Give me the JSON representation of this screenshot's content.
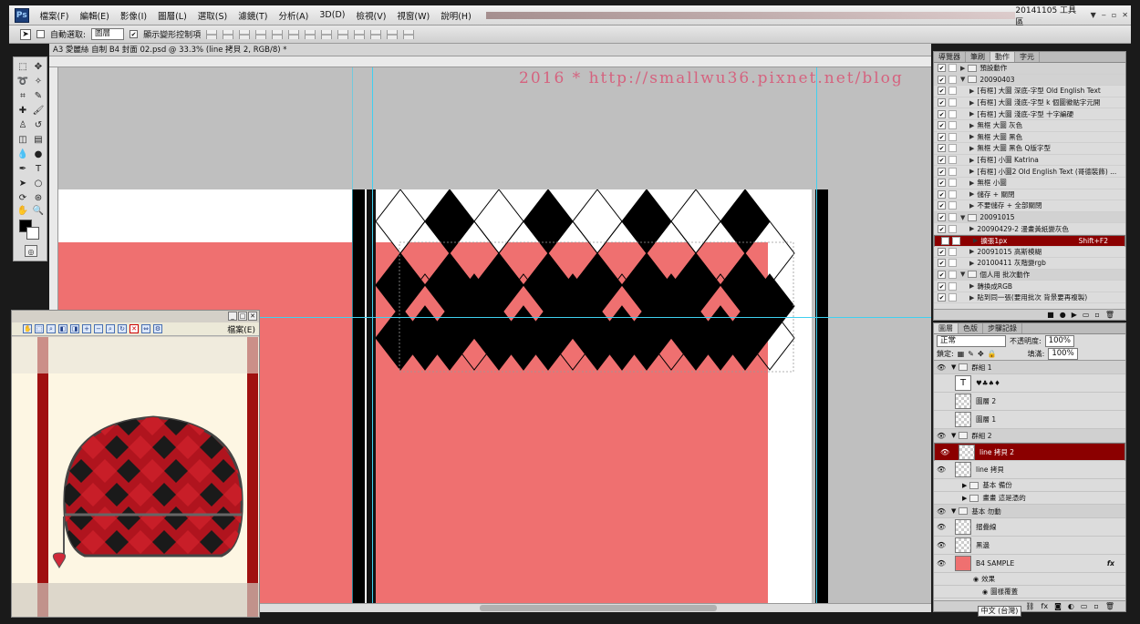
{
  "app": {
    "logo": "Ps",
    "workspace": "20141105 工具區",
    "window_buttons": [
      "‒",
      "▫",
      "✕"
    ]
  },
  "menu": [
    "檔案(F)",
    "編輯(E)",
    "影像(I)",
    "圖層(L)",
    "選取(S)",
    "濾鏡(T)",
    "分析(A)",
    "3D(D)",
    "檢視(V)",
    "視窗(W)",
    "說明(H)"
  ],
  "options": {
    "auto_select_label": "自動選取:",
    "auto_select_value": "圖層",
    "show_transform_label": "顯示變形控制項"
  },
  "document": {
    "tab": "A3 愛麗絲 自制 B4 封面 02.psd @ 33.3% (line 拷貝 2, RGB/8) *"
  },
  "watermark": "2016 * http://smallwu36.pixnet.net/blog",
  "viewer": {
    "file_label": "檔案(E)"
  },
  "actions_panel": {
    "tabs": [
      "導覽器",
      "筆刷",
      "動作",
      "字元"
    ],
    "active_tab": 2,
    "rows": [
      {
        "type": "set",
        "label": "預設動作",
        "check": "✔"
      },
      {
        "type": "set",
        "label": "20090403",
        "check": "✔",
        "open": true
      },
      {
        "type": "action",
        "label": "[有框] 大圖 深底-字型 Old English Text",
        "check": "✔"
      },
      {
        "type": "action",
        "label": "[有框] 大圖 淺底-字型 k 個圖徽骷字元開",
        "check": "✔"
      },
      {
        "type": "action",
        "label": "[有框] 大圖 淺底-字型 十字編硬",
        "check": "✔"
      },
      {
        "type": "action",
        "label": "無框 大圖 灰色",
        "check": "✔"
      },
      {
        "type": "action",
        "label": "無框 大圖 黑色",
        "check": "✔"
      },
      {
        "type": "action",
        "label": "無框 大圖 黑色 Q版字型",
        "check": "✔"
      },
      {
        "type": "action",
        "label": "[有框] 小圖 Katrina",
        "check": "✔"
      },
      {
        "type": "action",
        "label": "[有框] 小圖2 Old English Text (哥德裝飾) ...",
        "check": "✔"
      },
      {
        "type": "action",
        "label": "無框 小圖",
        "check": "✔"
      },
      {
        "type": "action",
        "label": "儲存 + 關閉",
        "check": "✔"
      },
      {
        "type": "action",
        "label": "不要儲存 + 全部關閉",
        "check": "✔"
      },
      {
        "type": "set",
        "label": "20091015",
        "check": "✔",
        "open": true
      },
      {
        "type": "action",
        "label": "20090429-2 漫畫黃紙變灰色",
        "check": "✔"
      },
      {
        "type": "action",
        "label": "擴張1px",
        "check": "✔",
        "selected": true,
        "shortcut": "Shift+F2"
      },
      {
        "type": "action",
        "label": "20091015 高斯模糊",
        "check": "✔"
      },
      {
        "type": "action",
        "label": "20100411 灰階變rgb",
        "check": "✔"
      },
      {
        "type": "set",
        "label": "個人用 批次動作",
        "check": "✔",
        "open": true
      },
      {
        "type": "action",
        "label": "轉換成RGB",
        "check": "✔"
      },
      {
        "type": "action",
        "label": "貼到同一張(要用批次 背景要再複製)",
        "check": "✔"
      }
    ]
  },
  "layers_panel": {
    "tabs": [
      "圖層",
      "色版",
      "步驟記錄"
    ],
    "blend_mode": "正常",
    "opacity_label": "不透明度:",
    "opacity": "100%",
    "lock_label": "鎖定:",
    "fill_label": "填滿:",
    "fill": "100%",
    "rows": [
      {
        "kind": "group",
        "label": "群組 1",
        "eye": "👁"
      },
      {
        "kind": "text",
        "label": "♥♣♠♦",
        "thumb": "T",
        "eye": ""
      },
      {
        "kind": "layer",
        "label": "圖層 2",
        "eye": ""
      },
      {
        "kind": "layer",
        "label": "圖層 1",
        "eye": ""
      },
      {
        "kind": "group",
        "label": "群組 2",
        "eye": "👁"
      },
      {
        "kind": "layer",
        "label": "line 拷貝 2",
        "eye": "👁",
        "selected": true
      },
      {
        "kind": "layer",
        "label": "line 拷貝",
        "eye": "👁"
      },
      {
        "kind": "subgroup",
        "label": "基本 備份",
        "eye": ""
      },
      {
        "kind": "subgroup",
        "label": "畫畫 這是憑的",
        "eye": ""
      },
      {
        "kind": "group",
        "label": "基本 勿動",
        "eye": "👁"
      },
      {
        "kind": "layer",
        "label": "摺疊線",
        "eye": "👁"
      },
      {
        "kind": "layer",
        "label": "黑邊",
        "eye": "👁"
      },
      {
        "kind": "layer",
        "label": "B4 SAMPLE",
        "eye": "👁",
        "fx": "fx"
      },
      {
        "kind": "effect",
        "label": "效果",
        "eye": ""
      },
      {
        "kind": "effect2",
        "label": "圖樣覆蓋",
        "eye": ""
      }
    ]
  },
  "ime": "中文 (台灣)"
}
